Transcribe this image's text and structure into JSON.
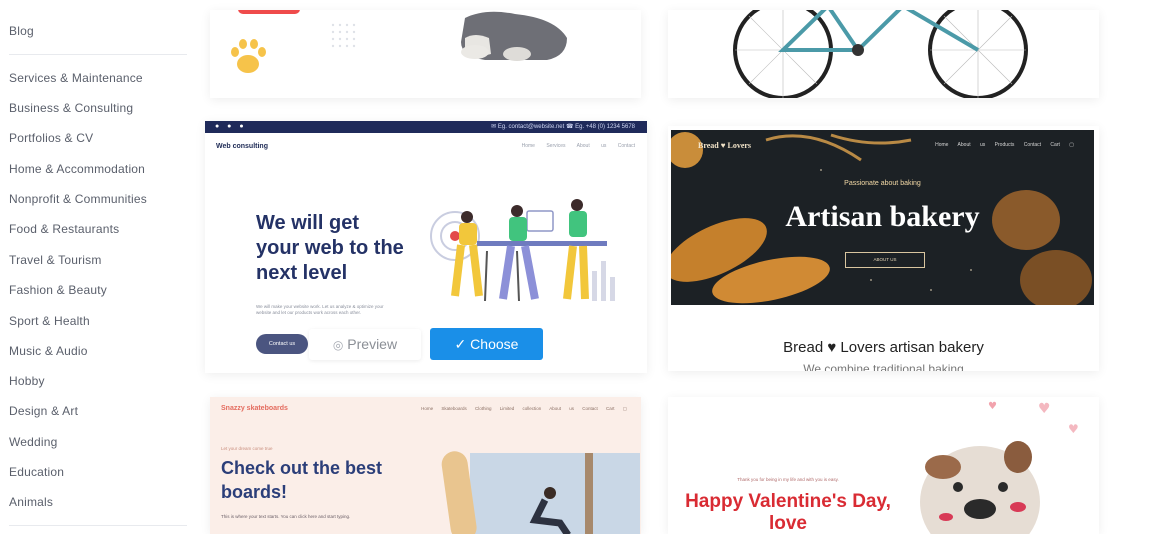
{
  "sidebar": {
    "items": [
      {
        "label": "Blog"
      },
      {
        "label": "Services & Maintenance"
      },
      {
        "label": "Business & Consulting"
      },
      {
        "label": "Portfolios & CV"
      },
      {
        "label": "Home & Accommodation"
      },
      {
        "label": "Nonprofit & Communities"
      },
      {
        "label": "Food & Restaurants"
      },
      {
        "label": "Travel & Tourism"
      },
      {
        "label": "Fashion & Beauty"
      },
      {
        "label": "Sport & Health"
      },
      {
        "label": "Music & Audio"
      },
      {
        "label": "Hobby"
      },
      {
        "label": "Design & Art"
      },
      {
        "label": "Wedding"
      },
      {
        "label": "Education"
      },
      {
        "label": "Animals"
      }
    ]
  },
  "cards": {
    "web_consulting": {
      "brand": "Web consulting",
      "headline": "We will get your web to the next level",
      "body": "We will make your website work. Let us analyze & optimize your website and let our products work across each other.",
      "contact_label": "Contact us",
      "topbar_contact": "✉ Eg. contact@website.net   ☎ Eg. +48 (0) 1234 5678",
      "nav": "Home  Services  About us  Contact"
    },
    "bakery": {
      "logo": "Bread ♥ Lovers",
      "nav": "Home  About us  Products  Contact  Cart ▢",
      "kicker": "Passionate about baking",
      "title": "Artisan bakery",
      "cta": "ABOUT US",
      "name": "Bread ♥ Lovers artisan bakery",
      "description": "We combine traditional baking"
    },
    "skate": {
      "logo": "Snazzy skateboards",
      "nav": "Home  Skateboards  Clothing  Limited collection  About us  Contact  Cart ▢",
      "kicker": "Let your dream come true",
      "title": "Check out the best boards!",
      "body": "This is where your text starts. You can click here and start typing."
    },
    "valentine": {
      "kicker": "Thank you for being in my life and with you is easy.",
      "title": "Happy Valentine's Day, love"
    }
  },
  "actions": {
    "preview_label": "Preview",
    "choose_label": "Choose"
  },
  "colors": {
    "accent": "#1a8fe8",
    "navy": "#243266",
    "valentine_red": "#d92b33"
  }
}
